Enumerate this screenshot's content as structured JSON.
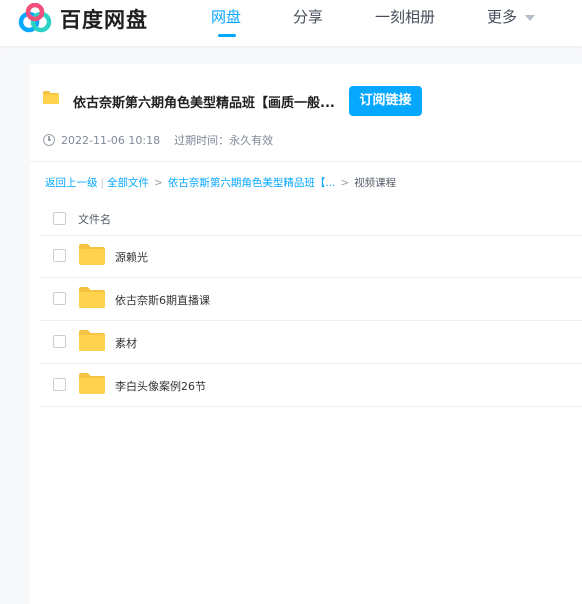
{
  "app": {
    "brand": "百度网盘",
    "nav": [
      {
        "label": "网盘",
        "active": true
      },
      {
        "label": "分享",
        "active": false
      },
      {
        "label": "一刻相册",
        "active": false
      },
      {
        "label": "更多",
        "active": false
      }
    ],
    "accent_color": "#06a7ff"
  },
  "share": {
    "title": "依古奈斯第六期角色美型精品班【画质一般...",
    "subscribe_label": "订阅链接",
    "date": "2022-11-06 10:18",
    "expiry_label": "过期时间：",
    "expiry_value": "永久有效"
  },
  "breadcrumb": {
    "back": "返回上一级",
    "separator": "|",
    "all_files": "全部文件",
    "parent": "依古奈斯第六期角色美型精品班【...",
    "current": "视频课程"
  },
  "file_list": {
    "header": "文件名",
    "files": [
      {
        "name": "源赖光",
        "type": "folder"
      },
      {
        "name": "依古奈斯6期直播课",
        "type": "folder"
      },
      {
        "name": "素材",
        "type": "folder"
      },
      {
        "name": "李白头像案例26节",
        "type": "folder"
      }
    ]
  }
}
